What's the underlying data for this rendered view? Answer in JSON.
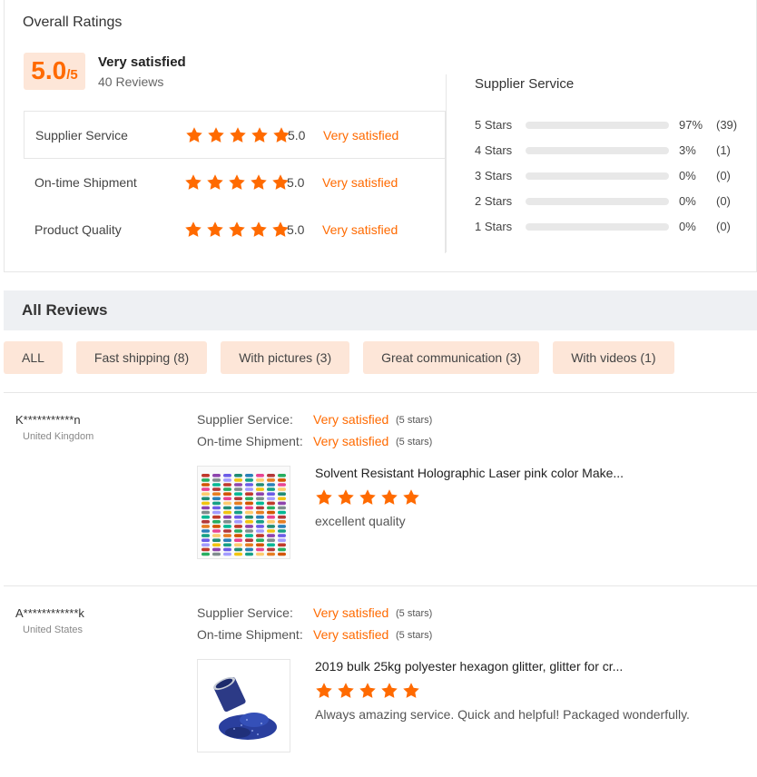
{
  "overall": {
    "title": "Overall Ratings",
    "score": "5.0",
    "score_max": "/5",
    "label": "Very satisfied",
    "reviews": "40 Reviews",
    "rows": [
      {
        "label": "Supplier Service",
        "score": "5.0",
        "text": "Very satisfied"
      },
      {
        "label": "On-time Shipment",
        "score": "5.0",
        "text": "Very satisfied"
      },
      {
        "label": "Product Quality",
        "score": "5.0",
        "text": "Very satisfied"
      }
    ]
  },
  "distribution": {
    "title": "Supplier Service",
    "rows": [
      {
        "label": "5  Stars",
        "pct": "97%",
        "count": "(39)",
        "fraction": 0.97
      },
      {
        "label": "4  Stars",
        "pct": "3%",
        "count": "(1)",
        "fraction": 0.03
      },
      {
        "label": "3  Stars",
        "pct": "0%",
        "count": "(0)",
        "fraction": 0
      },
      {
        "label": "2  Stars",
        "pct": "0%",
        "count": "(0)",
        "fraction": 0
      },
      {
        "label": "1  Stars",
        "pct": "0%",
        "count": "(0)",
        "fraction": 0
      }
    ]
  },
  "all_reviews": {
    "title": "All Reviews",
    "filters": [
      "ALL",
      "Fast shipping (8)",
      "With pictures (3)",
      "Great communication (3)",
      "With videos (1)"
    ]
  },
  "reviews": [
    {
      "user": "K***********n",
      "country": "United Kingdom",
      "service_label": "Supplier Service:",
      "service_value": "Very satisfied",
      "service_stars": "(5 stars)",
      "shipment_label": "On-time Shipment:",
      "shipment_value": "Very satisfied",
      "shipment_stars": "(5 stars)",
      "product": "Solvent Resistant Holographic Laser pink color Make...",
      "rating": 5,
      "comment": "excellent quality"
    },
    {
      "user": "A************k",
      "country": "United States",
      "service_label": "Supplier Service:",
      "service_value": "Very satisfied",
      "service_stars": "(5 stars)",
      "shipment_label": "On-time Shipment:",
      "shipment_value": "Very satisfied",
      "shipment_stars": "(5 stars)",
      "product": "2019 bulk 25kg polyester hexagon glitter, glitter for cr...",
      "rating": 5,
      "comment": "Always amazing service.  Quick and helpful!  Packaged wonderfully."
    }
  ],
  "colors": {
    "accent": "#ff6a00",
    "badge_bg": "#fde6d8",
    "header_bg": "#eef0f3"
  }
}
